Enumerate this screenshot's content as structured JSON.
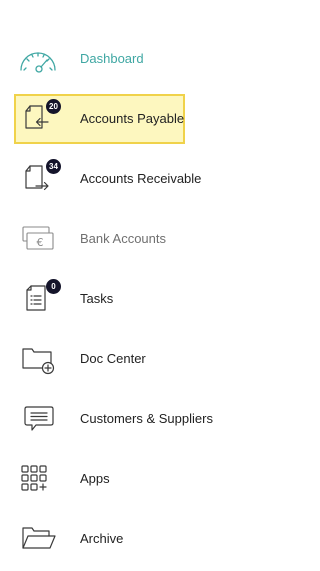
{
  "nav": {
    "items": [
      {
        "label": "Dashboard",
        "icon": "speedometer-icon",
        "active": false
      },
      {
        "label": "Accounts Payable",
        "icon": "document-arrow-in-icon",
        "badge": "20",
        "active": true
      },
      {
        "label": "Accounts Receivable",
        "icon": "document-arrow-out-icon",
        "badge": "34",
        "active": false
      },
      {
        "label": "Bank Accounts",
        "icon": "bank-card-euro-icon",
        "active": false
      },
      {
        "label": "Tasks",
        "icon": "task-list-icon",
        "badge": "0",
        "active": false
      },
      {
        "label": "Doc Center",
        "icon": "folder-plus-icon",
        "active": false
      },
      {
        "label": "Customers & Suppliers",
        "icon": "chat-bubble-icon",
        "active": false
      },
      {
        "label": "Apps",
        "icon": "apps-grid-icon",
        "active": false
      },
      {
        "label": "Archive",
        "icon": "open-folder-icon",
        "active": false
      }
    ]
  },
  "colors": {
    "accent": "#3fa7a3",
    "active_bg": "#fdf7bf",
    "active_border": "#f0d24a",
    "badge_bg": "#14142a",
    "muted_text": "#707070"
  }
}
